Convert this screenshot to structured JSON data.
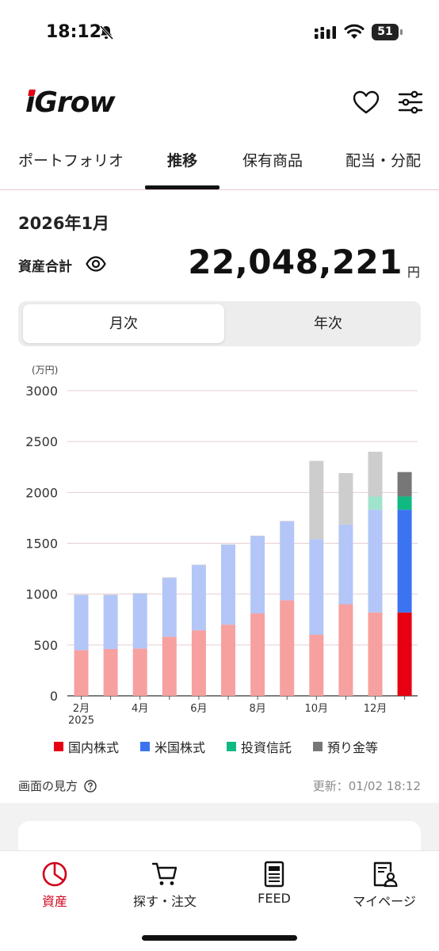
{
  "status_bar": {
    "time": "18:12",
    "battery": "51"
  },
  "app": {
    "logo": "iGrow"
  },
  "header": {
    "favorite_icon": "heart-icon",
    "settings_icon": "sliders-icon"
  },
  "tabs": [
    {
      "label": "ポートフォリオ",
      "active": false
    },
    {
      "label": "推移",
      "active": true
    },
    {
      "label": "保有商品",
      "active": false
    },
    {
      "label": "配当・分配",
      "active": false
    }
  ],
  "summary": {
    "month": "2026年1月",
    "total_label": "資産合計",
    "total_value": "22,048,221",
    "total_unit": "円"
  },
  "period_toggle": {
    "monthly": "月次",
    "yearly": "年次",
    "selected": "monthly"
  },
  "chart_data": {
    "type": "bar",
    "stacked": true,
    "unit_label": "(万円)",
    "ylim": [
      0,
      3000
    ],
    "yticks": [
      "0",
      "500",
      "1000",
      "1500",
      "2000",
      "2500",
      "3000"
    ],
    "categories": [
      "2025-02",
      "2025-03",
      "2025-04",
      "2025-05",
      "2025-06",
      "2025-07",
      "2025-08",
      "2025-09",
      "2025-10",
      "2025-11",
      "2025-12",
      "2026-01"
    ],
    "xtick_labels": [
      "2月",
      "",
      "4月",
      "",
      "6月",
      "",
      "8月",
      "",
      "10月",
      "",
      "12月",
      ""
    ],
    "xtick_sublabel": "2025",
    "series": [
      {
        "name": "国内株式",
        "color": "#e60012",
        "faded_color": "#f7a0a0",
        "values": [
          450,
          460,
          465,
          580,
          645,
          700,
          810,
          940,
          600,
          900,
          820,
          820
        ]
      },
      {
        "name": "米国株式",
        "color": "#3b73f1",
        "faded_color": "#b3c6f7",
        "values": [
          540,
          530,
          540,
          580,
          640,
          785,
          760,
          775,
          940,
          785,
          1010,
          1010
        ]
      },
      {
        "name": "投資信託",
        "color": "#10b981",
        "faded_color": "#a0e3cd",
        "values": [
          0,
          0,
          0,
          0,
          0,
          0,
          0,
          0,
          0,
          0,
          130,
          130
        ]
      },
      {
        "name": "預り金等",
        "color": "#777777",
        "faded_color": "#cdcdcd",
        "values": [
          5,
          5,
          5,
          5,
          5,
          5,
          5,
          5,
          770,
          505,
          440,
          240
        ]
      }
    ],
    "highlighted_index": 11,
    "grid": true
  },
  "footer_info": {
    "howto": "画面の見方",
    "updated": "更新：01/02 18:12"
  },
  "bottom_nav": [
    {
      "label": "資産",
      "icon": "pie-chart-icon",
      "active": true
    },
    {
      "label": "探す・注文",
      "icon": "cart-icon",
      "active": false
    },
    {
      "label": "FEED",
      "icon": "news-icon",
      "active": false
    },
    {
      "label": "マイページ",
      "icon": "profile-icon",
      "active": false
    }
  ]
}
